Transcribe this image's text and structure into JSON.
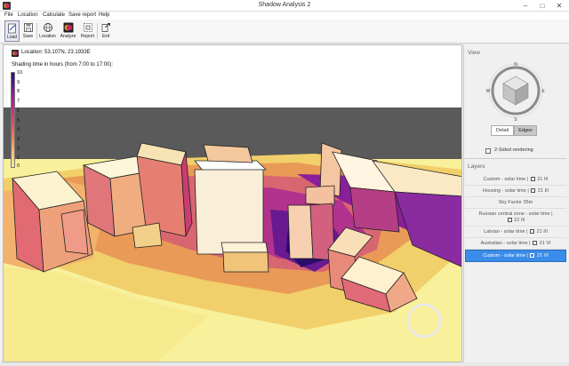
{
  "window": {
    "title": "Shadow Analysis 2",
    "minimize": "–",
    "maximize": "□",
    "close": "✕"
  },
  "menu": [
    "File",
    "Location",
    "Calculate",
    "Save report",
    "Help"
  ],
  "toolbar": [
    {
      "label": "Load",
      "icon": "load-icon",
      "active": true
    },
    {
      "label": "Save",
      "icon": "save-icon"
    },
    {
      "label": "Location",
      "icon": "globe-icon"
    },
    {
      "label": "Analyze",
      "icon": "analyze-icon"
    },
    {
      "label": "Report",
      "icon": "report-icon"
    },
    {
      "label": "Exit",
      "icon": "exit-icon"
    }
  ],
  "viewport": {
    "location": "Location: 53.107N, 23.1933E",
    "shading_title": "Shading time in hours (from 7:00 to 17:00):",
    "legend": {
      "min": 0,
      "max": 10,
      "ticks": [
        "10",
        "9",
        "8",
        "7",
        "6",
        "5",
        "4",
        "3",
        "2",
        "1",
        "0"
      ]
    }
  },
  "view_panel": {
    "heading": "View",
    "compass": {
      "n": "N",
      "s": "S",
      "e": "E",
      "w": "W"
    },
    "modes": [
      "Detail",
      "Edges"
    ],
    "selected_mode": "Edges",
    "two_sided_label": "2-Sided rendering",
    "two_sided_checked": false
  },
  "layers_panel": {
    "heading": "Layers",
    "items": [
      {
        "text": "Custom - solar time | ",
        "date": "21 III"
      },
      {
        "text": "Housing - solar time | ",
        "date": "21 III"
      },
      {
        "text": "Sky Factor 35m",
        "date": ""
      },
      {
        "text": "Russian central zone - solar time | ",
        "date": "22 III"
      },
      {
        "text": "Latvian - solar time | ",
        "date": "21 III"
      },
      {
        "text": "Australian - solar time | ",
        "date": "21 VI"
      },
      {
        "text": "Custom - solar time | ",
        "date": "21 VI",
        "selected": true
      }
    ]
  },
  "colors": {
    "accent": "#3b8ce8",
    "sky": "#ffffff",
    "backdrop": "#5a5a5a",
    "ground": "#f8f09a",
    "shade_max": "#2a0d6a"
  }
}
